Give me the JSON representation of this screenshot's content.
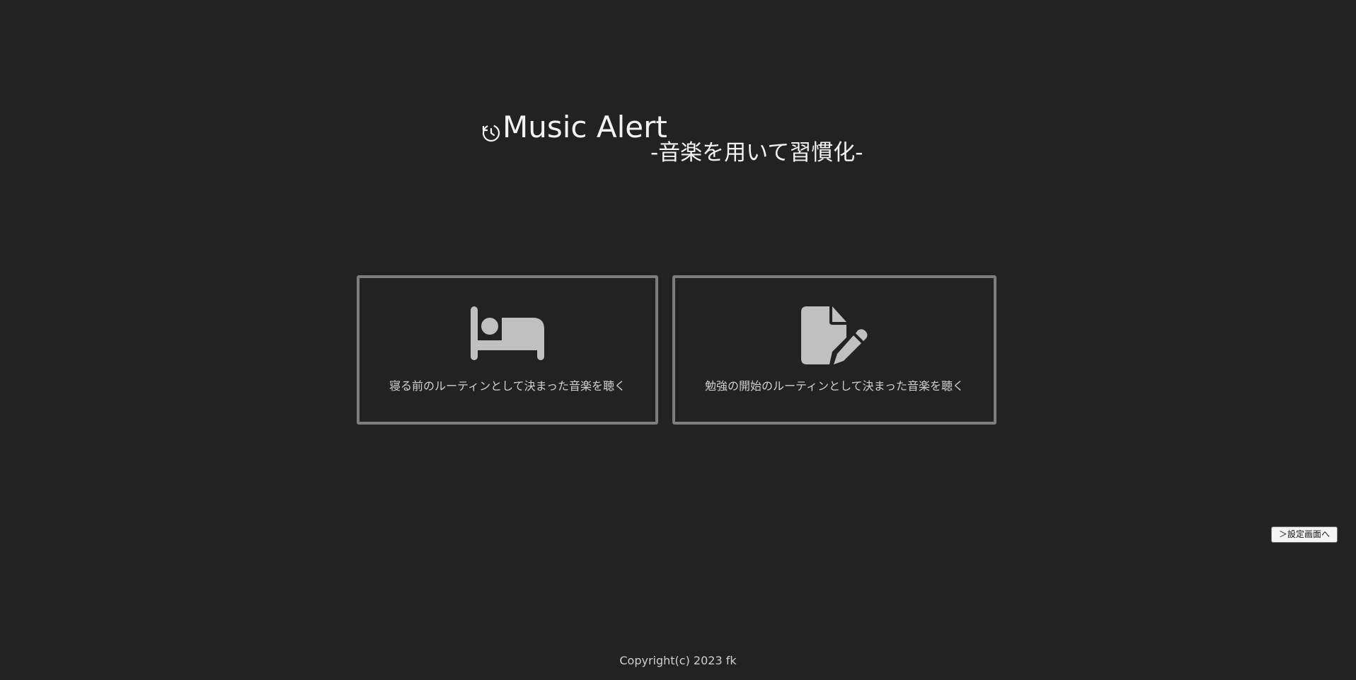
{
  "header": {
    "icon": "clock-rotate-icon",
    "title": "Music Alert",
    "subtitle": "-音楽を用いて習慣化-"
  },
  "cards": [
    {
      "icon": "bed-icon",
      "label": "寝る前のルーティンとして決まった音楽を聴く"
    },
    {
      "icon": "file-pen-icon",
      "label": "勉強の開始のルーティンとして決まった音楽を聴く"
    }
  ],
  "settings_button": {
    "label": "＞設定画面へ"
  },
  "footer": {
    "text": "Copyright(c) 2023 fk"
  },
  "colors": {
    "background": "#222222",
    "card_border": "#7d7d7d",
    "icon": "#c0c0c0",
    "text": "#f2f2f2"
  }
}
